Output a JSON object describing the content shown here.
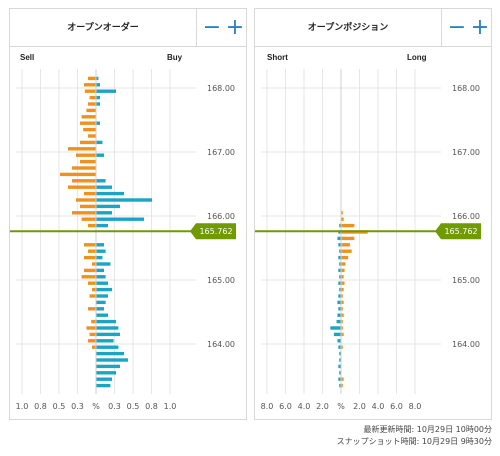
{
  "order_book": {
    "title": "オープンオーダー",
    "minus_label": "−",
    "plus_label": "+",
    "left_label": "Sell",
    "right_label": "Buy",
    "x_tick_labels": [
      "1.0",
      "0.8",
      "0.5",
      "0.3",
      "%",
      "0.3",
      "0.5",
      "0.8",
      "1.0"
    ]
  },
  "position_book": {
    "title": "オープンポジション",
    "minus_label": "−",
    "plus_label": "+",
    "left_label": "Short",
    "right_label": "Long",
    "x_tick_labels": [
      "8.0",
      "6.0",
      "4.0",
      "2.0",
      "%",
      "2.0",
      "4.0",
      "6.0",
      "8.0"
    ]
  },
  "price_labels": [
    "168.00",
    "167.00",
    "166.00",
    "165.00",
    "164.00"
  ],
  "current_price": "165.762",
  "colors": {
    "orange": "#f0911e",
    "teal": "#1aa5c3",
    "price": "#6f9a00",
    "grid": "#e6e6e6"
  },
  "footer": {
    "updated": "最新更新時間: 10月29日 10時00分",
    "snapshot": "スナップショット時間: 10月29日 9時30分"
  },
  "chart_data": [
    {
      "type": "bar",
      "title": "オープンオーダー",
      "orientation": "horizontal",
      "y_axis": "price",
      "ylim": [
        163.25,
        168.45
      ],
      "x_unit": "%",
      "xlim": [
        -1.0,
        1.0
      ],
      "current_price": 165.762,
      "series": [
        {
          "name": "Sell",
          "levels": [
            {
              "price": 168.15,
              "value": 0.1
            },
            {
              "price": 168.05,
              "value": 0.15
            },
            {
              "price": 167.95,
              "value": 0.14
            },
            {
              "price": 167.85,
              "value": 0.08
            },
            {
              "price": 167.75,
              "value": 0.1
            },
            {
              "price": 167.65,
              "value": 0.12
            },
            {
              "price": 167.55,
              "value": 0.18
            },
            {
              "price": 167.45,
              "value": 0.2
            },
            {
              "price": 167.35,
              "value": 0.16
            },
            {
              "price": 167.25,
              "value": 0.1
            },
            {
              "price": 167.15,
              "value": 0.2
            },
            {
              "price": 167.05,
              "value": 0.35
            },
            {
              "price": 166.95,
              "value": 0.25
            },
            {
              "price": 166.85,
              "value": 0.2
            },
            {
              "price": 166.75,
              "value": 0.3
            },
            {
              "price": 166.65,
              "value": 0.45
            },
            {
              "price": 166.55,
              "value": 0.3
            },
            {
              "price": 166.45,
              "value": 0.35
            },
            {
              "price": 166.35,
              "value": 0.15
            },
            {
              "price": 166.25,
              "value": 0.25
            },
            {
              "price": 166.15,
              "value": 0.2
            },
            {
              "price": 166.05,
              "value": 0.3
            },
            {
              "price": 165.95,
              "value": 0.18
            },
            {
              "price": 165.85,
              "value": 0.1
            },
            {
              "price": 165.55,
              "value": 0.15
            },
            {
              "price": 165.45,
              "value": 0.1
            },
            {
              "price": 165.35,
              "value": 0.15
            },
            {
              "price": 165.25,
              "value": 0.05
            },
            {
              "price": 165.15,
              "value": 0.15
            },
            {
              "price": 165.05,
              "value": 0.18
            },
            {
              "price": 164.95,
              "value": 0.1
            },
            {
              "price": 164.85,
              "value": 0.05
            },
            {
              "price": 164.75,
              "value": 0.08
            },
            {
              "price": 164.55,
              "value": 0.1
            },
            {
              "price": 164.35,
              "value": 0.06
            },
            {
              "price": 164.25,
              "value": 0.12
            },
            {
              "price": 164.15,
              "value": 0.08
            },
            {
              "price": 164.05,
              "value": 0.1
            },
            {
              "price": 163.95,
              "value": 0.05
            }
          ]
        },
        {
          "name": "Buy",
          "levels": [
            {
              "price": 168.15,
              "value": 0.03
            },
            {
              "price": 168.05,
              "value": 0.05
            },
            {
              "price": 167.95,
              "value": 0.25
            },
            {
              "price": 167.85,
              "value": 0.05
            },
            {
              "price": 167.75,
              "value": 0.05
            },
            {
              "price": 167.45,
              "value": 0.05
            },
            {
              "price": 167.15,
              "value": 0.08
            },
            {
              "price": 166.95,
              "value": 0.1
            },
            {
              "price": 166.55,
              "value": 0.12
            },
            {
              "price": 166.45,
              "value": 0.2
            },
            {
              "price": 166.35,
              "value": 0.35
            },
            {
              "price": 166.25,
              "value": 0.7
            },
            {
              "price": 166.15,
              "value": 0.3
            },
            {
              "price": 166.05,
              "value": 0.2
            },
            {
              "price": 165.95,
              "value": 0.6
            },
            {
              "price": 165.85,
              "value": 0.15
            },
            {
              "price": 165.55,
              "value": 0.1
            },
            {
              "price": 165.45,
              "value": 0.12
            },
            {
              "price": 165.35,
              "value": 0.08
            },
            {
              "price": 165.25,
              "value": 0.18
            },
            {
              "price": 165.15,
              "value": 0.1
            },
            {
              "price": 165.05,
              "value": 0.12
            },
            {
              "price": 164.95,
              "value": 0.15
            },
            {
              "price": 164.85,
              "value": 0.2
            },
            {
              "price": 164.75,
              "value": 0.15
            },
            {
              "price": 164.65,
              "value": 0.12
            },
            {
              "price": 164.55,
              "value": 0.1
            },
            {
              "price": 164.45,
              "value": 0.15
            },
            {
              "price": 164.35,
              "value": 0.25
            },
            {
              "price": 164.25,
              "value": 0.28
            },
            {
              "price": 164.15,
              "value": 0.3
            },
            {
              "price": 164.05,
              "value": 0.22
            },
            {
              "price": 163.95,
              "value": 0.28
            },
            {
              "price": 163.85,
              "value": 0.35
            },
            {
              "price": 163.75,
              "value": 0.4
            },
            {
              "price": 163.65,
              "value": 0.3
            },
            {
              "price": 163.55,
              "value": 0.25
            },
            {
              "price": 163.45,
              "value": 0.2
            },
            {
              "price": 163.35,
              "value": 0.18
            }
          ]
        }
      ]
    },
    {
      "type": "bar",
      "title": "オープンポジション",
      "orientation": "horizontal",
      "y_axis": "price",
      "ylim": [
        163.25,
        168.45
      ],
      "x_unit": "%",
      "xlim": [
        -9.0,
        9.0
      ],
      "current_price": 165.762,
      "series": [
        {
          "name": "Short",
          "levels": [
            {
              "price": 165.85,
              "value": 0.2
            },
            {
              "price": 165.75,
              "value": 0.3
            },
            {
              "price": 165.65,
              "value": 0.4
            },
            {
              "price": 165.55,
              "value": 0.3
            },
            {
              "price": 165.45,
              "value": 0.2
            },
            {
              "price": 165.35,
              "value": 0.3
            },
            {
              "price": 165.25,
              "value": 0.2
            },
            {
              "price": 165.15,
              "value": 0.3
            },
            {
              "price": 165.05,
              "value": 0.2
            },
            {
              "price": 164.95,
              "value": 0.3
            },
            {
              "price": 164.85,
              "value": 0.2
            },
            {
              "price": 164.75,
              "value": 0.3
            },
            {
              "price": 164.65,
              "value": 0.4
            },
            {
              "price": 164.55,
              "value": 0.3
            },
            {
              "price": 164.45,
              "value": 0.4
            },
            {
              "price": 164.35,
              "value": 0.5
            },
            {
              "price": 164.25,
              "value": 1.2
            },
            {
              "price": 164.15,
              "value": 0.8
            },
            {
              "price": 164.05,
              "value": 0.4
            },
            {
              "price": 163.95,
              "value": 0.3
            },
            {
              "price": 163.85,
              "value": 0.2
            },
            {
              "price": 163.75,
              "value": 0.2
            },
            {
              "price": 163.65,
              "value": 0.3
            },
            {
              "price": 163.55,
              "value": 0.2
            },
            {
              "price": 163.45,
              "value": 0.3
            },
            {
              "price": 163.35,
              "value": 0.2
            }
          ]
        },
        {
          "name": "Long",
          "levels": [
            {
              "price": 166.05,
              "value": 0.2
            },
            {
              "price": 165.95,
              "value": 0.3
            },
            {
              "price": 165.85,
              "value": 1.5
            },
            {
              "price": 165.75,
              "value": 3.0
            },
            {
              "price": 165.65,
              "value": 1.5
            },
            {
              "price": 165.55,
              "value": 1.0
            },
            {
              "price": 165.45,
              "value": 1.2
            },
            {
              "price": 165.35,
              "value": 0.8
            },
            {
              "price": 165.25,
              "value": 0.5
            },
            {
              "price": 165.15,
              "value": 0.4
            },
            {
              "price": 165.05,
              "value": 0.3
            },
            {
              "price": 164.95,
              "value": 0.4
            },
            {
              "price": 164.85,
              "value": 0.3
            },
            {
              "price": 164.75,
              "value": 0.2
            },
            {
              "price": 164.65,
              "value": 0.3
            },
            {
              "price": 164.55,
              "value": 0.2
            },
            {
              "price": 164.45,
              "value": 0.3
            },
            {
              "price": 164.35,
              "value": 0.2
            },
            {
              "price": 164.25,
              "value": 0.2
            },
            {
              "price": 164.15,
              "value": 0.3
            },
            {
              "price": 163.95,
              "value": 0.2
            },
            {
              "price": 163.45,
              "value": 0.3
            },
            {
              "price": 163.35,
              "value": 0.2
            }
          ]
        }
      ]
    }
  ]
}
